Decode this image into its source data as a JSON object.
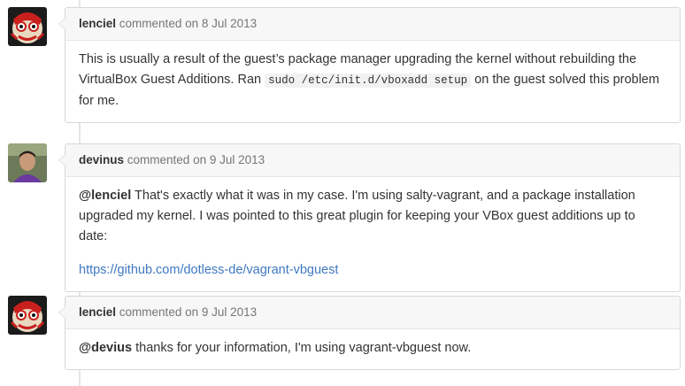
{
  "comments": [
    {
      "author": "lenciel",
      "meta": "commented on 8 Jul 2013",
      "text_before": "This is usually a result of the guest’s package manager upgrading the kernel without rebuilding the VirtualBox Guest Additions. Ran ",
      "code": "sudo /etc/init.d/vboxadd setup",
      "text_after": " on the guest solved this problem for me."
    },
    {
      "author": "devinus",
      "meta": "commented on 9 Jul 2013",
      "mention": "@lenciel",
      "text": " That's exactly what it was in my case. I'm using salty-vagrant, and a package installation upgraded my kernel. I was pointed to this great plugin for keeping your VBox guest additions up to date:",
      "link": "https://github.com/dotless-de/vagrant-vbguest"
    },
    {
      "author": "lenciel",
      "meta": "commented on 9 Jul 2013",
      "mention": "@devius",
      "text": " thanks for your information, I'm using vagrant-vbguest now."
    }
  ]
}
